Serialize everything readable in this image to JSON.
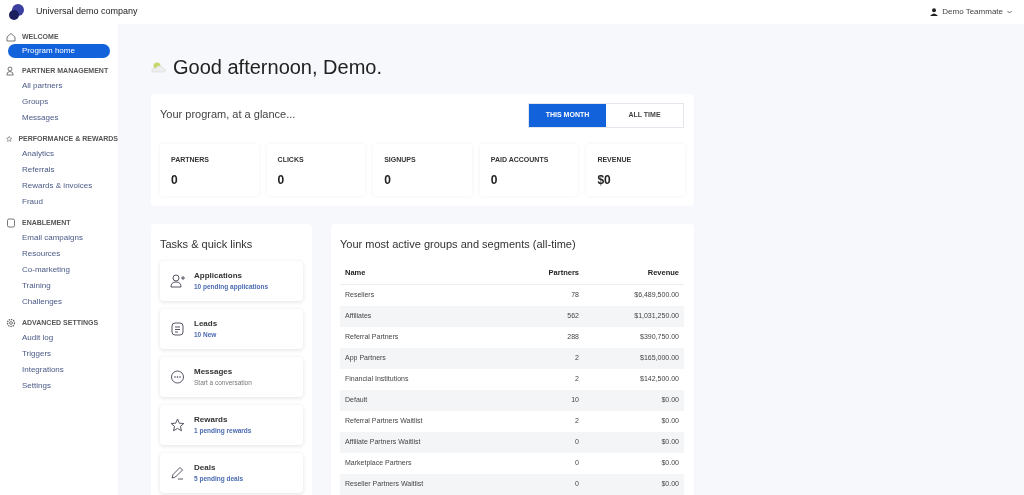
{
  "header": {
    "company": "Universal demo company",
    "user": "Demo Teammate"
  },
  "sidebar": {
    "sections": [
      {
        "kind": "home",
        "title": "WELCOME",
        "items": [
          {
            "label": "Program home",
            "selected": true
          }
        ]
      },
      {
        "kind": "people",
        "title": "PARTNER MANAGEMENT",
        "items": [
          {
            "label": "All partners",
            "selected": false
          },
          {
            "label": "Groups",
            "selected": false
          },
          {
            "label": "Messages",
            "selected": false
          }
        ]
      },
      {
        "kind": "star",
        "title": "PERFORMANCE & REWARDS",
        "items": [
          {
            "label": "Analytics",
            "selected": false
          },
          {
            "label": "Referrals",
            "selected": false
          },
          {
            "label": "Rewards & invoices",
            "selected": false
          },
          {
            "label": "Fraud",
            "selected": false
          }
        ]
      },
      {
        "kind": "doc",
        "title": "ENABLEMENT",
        "items": [
          {
            "label": "Email campaigns",
            "selected": false
          },
          {
            "label": "Resources",
            "selected": false
          },
          {
            "label": "Co-marketing",
            "selected": false
          },
          {
            "label": "Training",
            "selected": false
          },
          {
            "label": "Challenges",
            "selected": false
          }
        ]
      },
      {
        "kind": "gear",
        "title": "ADVANCED SETTINGS",
        "items": [
          {
            "label": "Audit log",
            "selected": false
          },
          {
            "label": "Triggers",
            "selected": false
          },
          {
            "label": "Integrations",
            "selected": false
          },
          {
            "label": "Settings",
            "selected": false
          }
        ]
      }
    ]
  },
  "greeting": "Good afternoon, Demo.",
  "glance": {
    "title": "Your program, at a glance...",
    "periods": [
      {
        "label": "THIS MONTH",
        "selected": true
      },
      {
        "label": "ALL TIME",
        "selected": false
      }
    ],
    "stats": [
      {
        "label": "PARTNERS",
        "value": "0"
      },
      {
        "label": "CLICKS",
        "value": "0"
      },
      {
        "label": "SIGNUPS",
        "value": "0"
      },
      {
        "label": "PAID ACCOUNTS",
        "value": "0"
      },
      {
        "label": "REVENUE",
        "value": "$0"
      }
    ]
  },
  "tasks": {
    "title": "Tasks & quick links",
    "items": [
      {
        "kind": "person-add",
        "title": "Applications",
        "subtitle": "10 pending applications",
        "highlight": true
      },
      {
        "kind": "list",
        "title": "Leads",
        "subtitle": "10 New",
        "highlight": true
      },
      {
        "kind": "chat",
        "title": "Messages",
        "subtitle": "Start a conversation",
        "highlight": false
      },
      {
        "kind": "star",
        "title": "Rewards",
        "subtitle": "1 pending rewards",
        "highlight": true
      },
      {
        "kind": "pen",
        "title": "Deals",
        "subtitle": "5 pending deals",
        "highlight": true
      }
    ]
  },
  "groups": {
    "title": "Your most active groups and segments (all-time)",
    "columns": [
      "Name",
      "Partners",
      "Revenue"
    ],
    "rows": [
      [
        "Resellers",
        "78",
        "$6,489,500.00"
      ],
      [
        "Affiliates",
        "562",
        "$1,031,250.00"
      ],
      [
        "Referral Partners",
        "288",
        "$390,750.00"
      ],
      [
        "App Partners",
        "2",
        "$165,000.00"
      ],
      [
        "Financial Institutions",
        "2",
        "$142,500.00"
      ],
      [
        "Default",
        "10",
        "$0.00"
      ],
      [
        "Referral Partners Waitlist",
        "2",
        "$0.00"
      ],
      [
        "Affiliate Partners Waitlist",
        "0",
        "$0.00"
      ],
      [
        "Marketplace Partners",
        "0",
        "$0.00"
      ],
      [
        "Reseller Partners Waitlist",
        "0",
        "$0.00"
      ]
    ]
  }
}
